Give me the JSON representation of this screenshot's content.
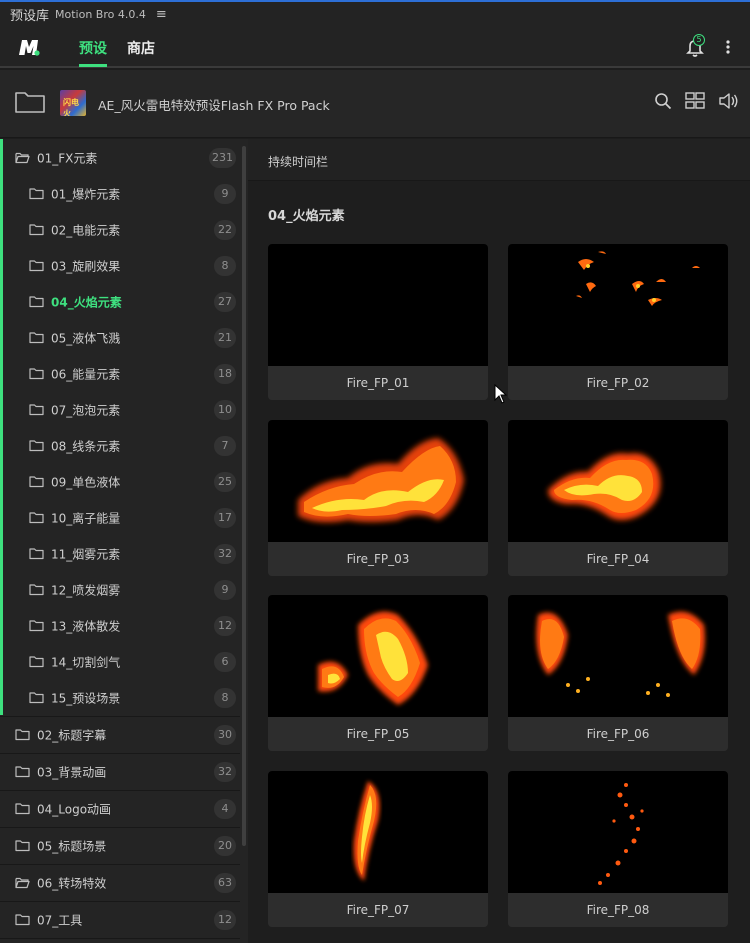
{
  "titlebar": {
    "app_title": "预设库",
    "app_name": "Motion Bro 4.0.4",
    "menu_icon": "hamburger-icon"
  },
  "nav": {
    "tabs": [
      {
        "label": "预设",
        "active": true
      },
      {
        "label": "商店",
        "active": false
      }
    ],
    "notification_count": "5",
    "accent_color": "#3ee07f"
  },
  "pack": {
    "title": "AE_风火雷电特效预设Flash FX Pro Pack",
    "thumb_text": "闪电火"
  },
  "sidebar": {
    "items": [
      {
        "label": "01_FX元素",
        "count": "231"
      },
      {
        "label": "01_爆炸元素",
        "count": "9"
      },
      {
        "label": "02_电能元素",
        "count": "22"
      },
      {
        "label": "03_旋刷效果",
        "count": "8"
      },
      {
        "label": "04_火焰元素",
        "count": "27"
      },
      {
        "label": "05_液体飞溅",
        "count": "21"
      },
      {
        "label": "06_能量元素",
        "count": "18"
      },
      {
        "label": "07_泡泡元素",
        "count": "10"
      },
      {
        "label": "08_线条元素",
        "count": "7"
      },
      {
        "label": "09_单色液体",
        "count": "25"
      },
      {
        "label": "10_离子能量",
        "count": "17"
      },
      {
        "label": "11_烟雾元素",
        "count": "32"
      },
      {
        "label": "12_喷发烟雾",
        "count": "9"
      },
      {
        "label": "13_液体散发",
        "count": "12"
      },
      {
        "label": "14_切割剑气",
        "count": "6"
      },
      {
        "label": "15_预设场景",
        "count": "8"
      },
      {
        "label": "02_标题字幕",
        "count": "30"
      },
      {
        "label": "03_背景动画",
        "count": "32"
      },
      {
        "label": "04_Logo动画",
        "count": "4"
      },
      {
        "label": "05_标题场景",
        "count": "20"
      },
      {
        "label": "06_转场特效",
        "count": "63"
      },
      {
        "label": "07_工具",
        "count": "12"
      }
    ]
  },
  "main": {
    "duration_bar": "持续时间栏",
    "section_title": "04_火焰元素",
    "presets": [
      {
        "name": "Fire_FP_01"
      },
      {
        "name": "Fire_FP_02"
      },
      {
        "name": "Fire_FP_03"
      },
      {
        "name": "Fire_FP_04"
      },
      {
        "name": "Fire_FP_05"
      },
      {
        "name": "Fire_FP_06"
      },
      {
        "name": "Fire_FP_07"
      },
      {
        "name": "Fire_FP_08"
      }
    ]
  }
}
